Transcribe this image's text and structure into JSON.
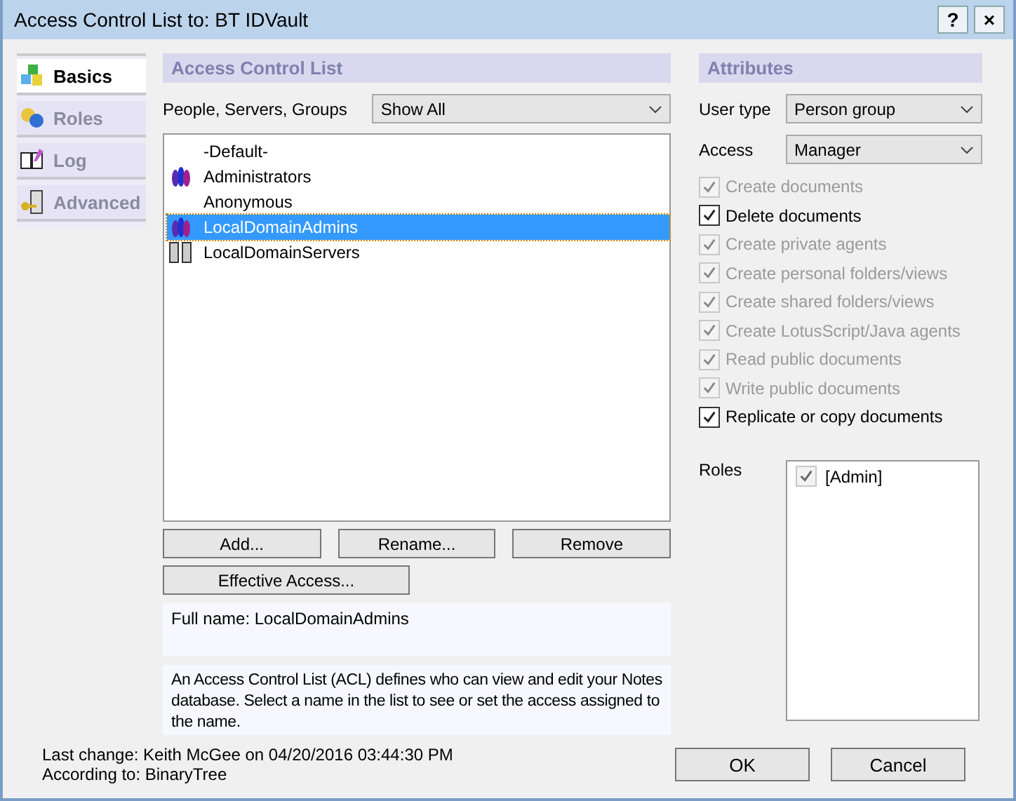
{
  "window": {
    "title": "Access Control List to: BT IDVault",
    "help": "?",
    "close": "×"
  },
  "tabs": [
    {
      "label": "Basics",
      "selected": true
    },
    {
      "label": "Roles",
      "selected": false
    },
    {
      "label": "Log",
      "selected": false
    },
    {
      "label": "Advanced",
      "selected": false
    }
  ],
  "acl": {
    "header": "Access Control List",
    "filter_label": "People, Servers, Groups",
    "filter_value": "Show All",
    "entries": [
      {
        "name": "-Default-",
        "kind": "none",
        "selected": false
      },
      {
        "name": "Administrators",
        "kind": "group",
        "selected": false
      },
      {
        "name": "Anonymous",
        "kind": "none",
        "selected": false
      },
      {
        "name": "LocalDomainAdmins",
        "kind": "group",
        "selected": true
      },
      {
        "name": "LocalDomainServers",
        "kind": "server",
        "selected": false
      }
    ],
    "buttons": [
      "Add...",
      "Rename...",
      "Remove"
    ],
    "effective_access_button": "Effective Access...",
    "full_name": "Full name: LocalDomainAdmins",
    "description": "An Access Control List (ACL) defines who can view and edit your Notes database.  Select a name in the list to see or set the access assigned to the name."
  },
  "attributes": {
    "header": "Attributes",
    "user_type_label": "User type",
    "user_type": "Person group",
    "access_label": "Access",
    "access": "Manager",
    "permissions": [
      {
        "label": "Create documents",
        "checked": true,
        "disabled": true
      },
      {
        "label": "Delete documents",
        "checked": true,
        "disabled": false
      },
      {
        "label": "Create private agents",
        "checked": true,
        "disabled": true
      },
      {
        "label": "Create personal folders/views",
        "checked": true,
        "disabled": true
      },
      {
        "label": "Create shared folders/views",
        "checked": true,
        "disabled": true
      },
      {
        "label": "Create LotusScript/Java agents",
        "checked": true,
        "disabled": true
      },
      {
        "label": "Read public documents",
        "checked": true,
        "disabled": true
      },
      {
        "label": "Write public documents",
        "checked": true,
        "disabled": true
      },
      {
        "label": "Replicate or copy documents",
        "checked": true,
        "disabled": false
      }
    ],
    "roles_label": "Roles",
    "roles": [
      {
        "label": "[Admin]",
        "checked": true,
        "disabled": true
      }
    ]
  },
  "footer": {
    "last_change": "Last change: Keith McGee on 04/20/2016 03:44:30 PM",
    "according_to": "According to: BinaryTree",
    "ok": "OK",
    "cancel": "Cancel"
  }
}
